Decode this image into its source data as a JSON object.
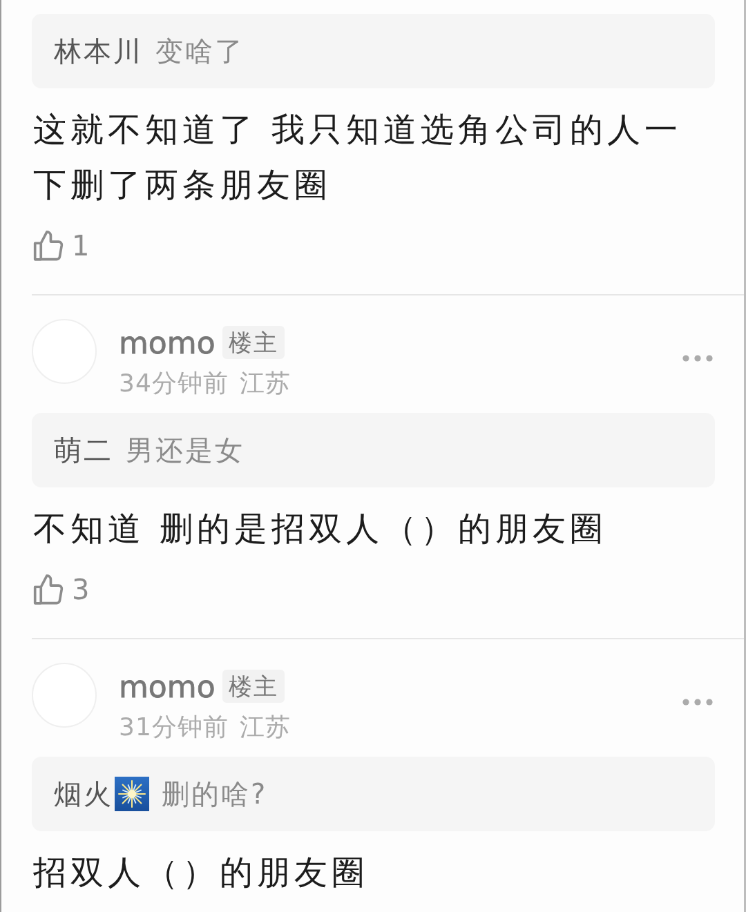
{
  "comments": [
    {
      "quote": {
        "name": "林本川",
        "text": "变啥了",
        "emoji": false
      },
      "body": "这就不知道了 我只知道选角公司的人一下删了两条朋友圈",
      "likes": "1"
    },
    {
      "author": "momo",
      "badge": "楼主",
      "time": "34分钟前",
      "location": "江苏",
      "quote": {
        "name": "萌二",
        "text": "男还是女",
        "emoji": false
      },
      "body": "不知道 删的是招双人（）的朋友圈",
      "likes": "3"
    },
    {
      "author": "momo",
      "badge": "楼主",
      "time": "31分钟前",
      "location": "江苏",
      "quote": {
        "name": "烟火",
        "text": "删的啥?",
        "emoji": true
      },
      "body": "招双人（）的朋友圈"
    }
  ]
}
